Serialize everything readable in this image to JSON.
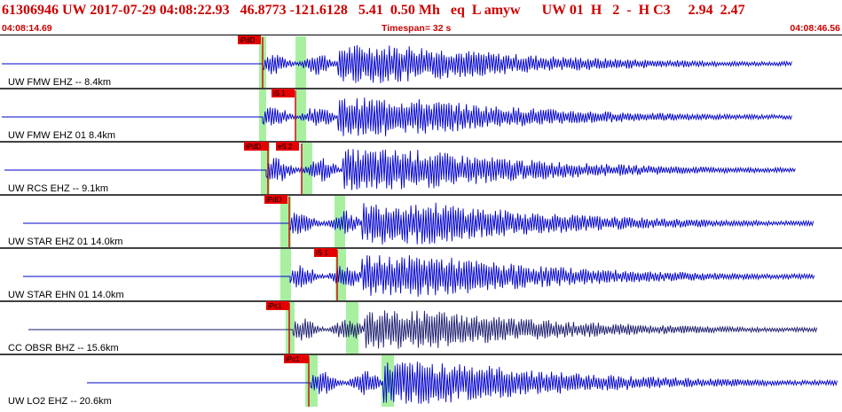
{
  "header": {
    "event_line": "61306946 UW 2017-07-29 04:08:22.93   46.8773 -121.6128   5.41  0.50 Mh   eq  L amyw      UW 01  H   2  -  H C3     2.94  2.47",
    "start_time": "04:08:14.69",
    "timespan": "Timespan=  32 s",
    "end_time": "04:08:46.56"
  },
  "colors": {
    "header_text": "#cc0000",
    "trace": "#0000cc",
    "trace_dark": "#1a1a6e",
    "pick_flag": "#e60000",
    "window": "#a8f0a0",
    "separator": "#000000"
  },
  "traces": [
    {
      "label": "UW FMW EHZ -- 8.4km",
      "picks": [
        "iPdD"
      ],
      "dark": false
    },
    {
      "label": "UW FMW EHZ 01 8.4km",
      "picks": [
        "iS 1"
      ],
      "dark": false
    },
    {
      "label": "UW RCS EHZ -- 9.1km",
      "picks": [
        "iPdD",
        "eS 2"
      ],
      "dark": false
    },
    {
      "label": "UW STAR EHZ 01 14.0km",
      "picks": [
        "iPdD"
      ],
      "dark": false
    },
    {
      "label": "UW STAR EHN 01 14.0km",
      "picks": [
        "iS 1"
      ],
      "dark": false
    },
    {
      "label": "CC OBSR BHZ -- 15.6km",
      "picks": [
        "iPc1"
      ],
      "dark": true
    },
    {
      "label": "UW LO2 EHZ -- 20.6km",
      "picks": [
        "iPc1"
      ],
      "dark": false
    }
  ]
}
